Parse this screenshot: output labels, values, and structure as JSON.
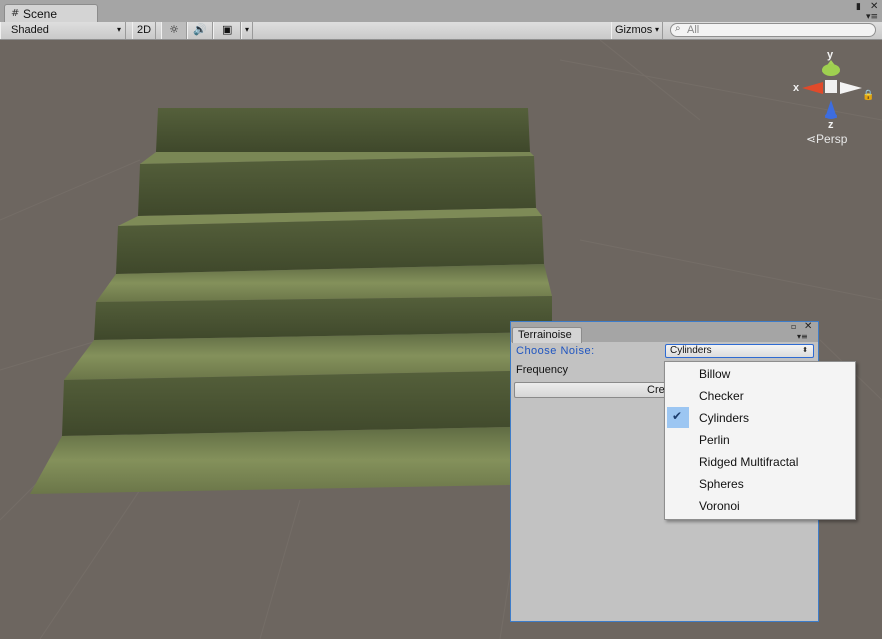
{
  "window": {
    "tab_label": "Scene",
    "tab_icon": "grid-icon",
    "controls": {
      "lock": "▮",
      "close": "✕",
      "menu": "▾≡"
    }
  },
  "toolbar": {
    "shading_mode": "Shaded",
    "dropdown_arrow": "▾",
    "mode_2d_label": "2D",
    "lighting_icon": "☼",
    "audio_icon": "🔊",
    "effects_icon": "▣",
    "gizmos_label": "Gizmos",
    "search_icon": "⌕",
    "search_placeholder": "All"
  },
  "viewport": {
    "lock_icon": "🔒",
    "gizmo": {
      "y": "y",
      "x": "x",
      "z": "z"
    },
    "projection_label": "⋖Persp"
  },
  "terrainoise": {
    "tab_label": "Terrainoise",
    "controls": {
      "maximize": "▫",
      "close": "✕",
      "menu": "▾≡"
    },
    "choose_noise_label": "Choose Noise:",
    "selected_noise": "Cylinders",
    "select_arrow": "⬍",
    "frequency_label": "Frequency",
    "create_label": "Cre"
  },
  "dropdown": {
    "check_glyph": "✔",
    "options": [
      "Billow",
      "Checker",
      "Cylinders",
      "Perlin",
      "Ridged Multifractal",
      "Spheres",
      "Voronoi"
    ],
    "selected_index": 2
  },
  "colors": {
    "accent_blue": "#3d7cc9",
    "selection_highlight": "#9cc6f2",
    "stair_top": "#7d8a56",
    "stair_face": "#4a5434",
    "viewport_bg": "#6d6660"
  }
}
